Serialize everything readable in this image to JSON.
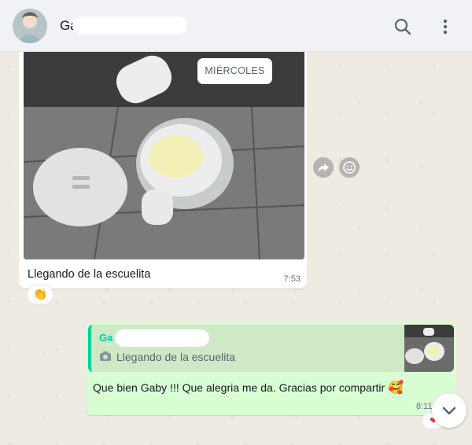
{
  "header": {
    "contact_name": "Ga",
    "search_icon": "search-icon",
    "menu_icon": "kebab-menu-icon"
  },
  "chat": {
    "date_chip": "MIÉRCOLES",
    "incoming": {
      "caption": "Llegando de la escuelita",
      "time": "7:53",
      "reaction": "👏",
      "actions": [
        "forward-icon",
        "emoji-react-icon"
      ]
    },
    "outgoing": {
      "quote_author": "Ga",
      "quote_text": "Llegando de la escuelita",
      "text": "Que bien Gaby !!!   Que alegria me da.  Gracias por compartir ",
      "emoji": "🥰",
      "time": "8:11",
      "reaction": "❤"
    }
  },
  "colors": {
    "header_bg": "#f0f2f5",
    "chat_bg": "#efeae2",
    "outgoing_bubble": "#d9fdd3",
    "quote_accent": "#06cf9c"
  }
}
